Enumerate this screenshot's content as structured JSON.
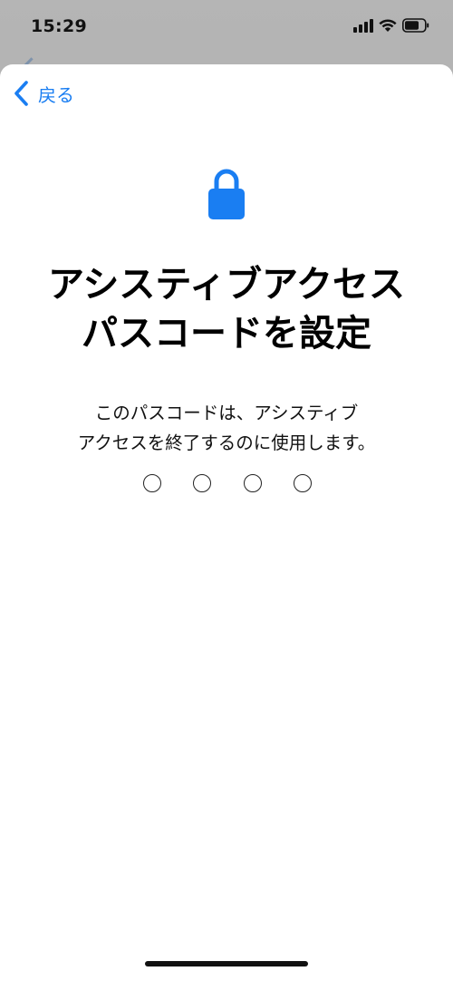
{
  "status_bar": {
    "time": "15:29",
    "icons": [
      "signal-icon",
      "wifi-icon",
      "battery-icon"
    ]
  },
  "nav": {
    "back_label": "戻る",
    "back_icon": "chevron-left-icon"
  },
  "main": {
    "icon": "lock-icon",
    "title_line1": "アシスティブアクセス",
    "title_line2": "パスコードを設定",
    "subtitle_line1": "このパスコードは、アシスティブ",
    "subtitle_line2": "アクセスを終了するのに使用します。",
    "passcode": {
      "length": 4,
      "entered": 0
    }
  },
  "colors": {
    "accent": "#1a7ef2",
    "sheet_background": "#ffffff",
    "dimmed_background": "#a9a9a9"
  }
}
